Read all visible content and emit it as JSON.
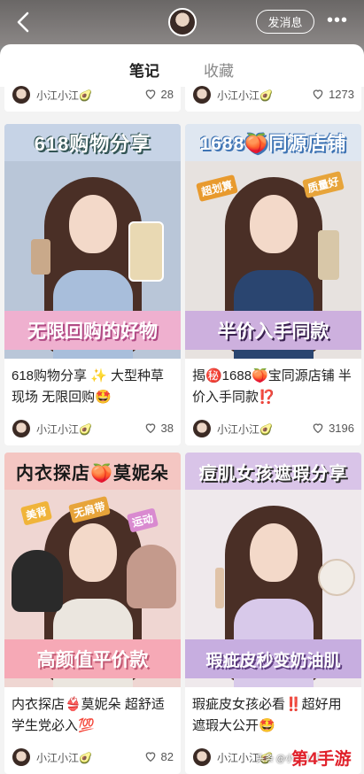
{
  "header": {
    "message_button": "发消息",
    "more": "•••"
  },
  "tabs": [
    {
      "label": "笔记",
      "active": true
    },
    {
      "label": "收藏",
      "active": false
    }
  ],
  "top_strip": {
    "left": {
      "author": "小江小江🥑",
      "likes": "28"
    },
    "right": {
      "author": "小江小江🥑",
      "likes": "1273"
    }
  },
  "cards": [
    {
      "banner": "618购物分享",
      "footer": "无限回购的好物",
      "title": "618购物分享 ✨ 大型种草现场 无限回购🤩",
      "author": "小江小江🥑",
      "likes": "38",
      "colors": {
        "bg": "#b8c8dc",
        "banner": "#c9d8ea",
        "text": "#ffffff",
        "footer": "#e9a7c8",
        "body": "#9fb7d6"
      }
    },
    {
      "banner": "1688🍑同源店铺",
      "stickers": [
        "超划算",
        "质量好"
      ],
      "footer": "半价入手同款",
      "title": "揭㊙️1688🍑宝同源店铺 半价入手同款⁉️",
      "author": "小江小江🥑",
      "likes": "3196",
      "colors": {
        "bg": "#e8e4e1",
        "banner": "#5a8fc7",
        "text": "#ffffff",
        "footer": "#c9a6d8",
        "body": "#27436b"
      }
    },
    {
      "banner": "内衣探店🍑莫妮朵",
      "stickers": [
        "美背",
        "无肩带",
        "运动"
      ],
      "footer": "高颜值平价款",
      "title": "内衣探店👙莫妮朵 超舒适 学生党必入💯",
      "author": "小江小江🥑",
      "likes": "82",
      "colors": {
        "bg": "#f1d6d0",
        "banner": "#f2c0bb",
        "text": "#1d1d1d",
        "footer": "#f1a6b2",
        "body": "#e9e3da"
      }
    },
    {
      "banner": "痘肌女孩遮瑕分享",
      "footer": "瑕疵皮秒变奶油肌",
      "title": "瑕疵皮女孩必看‼️超好用遮瑕大公开🤩",
      "author": "小江小江🥑",
      "likes": "",
      "colors": {
        "bg": "#ede7e9",
        "banner": "#c7b0d8",
        "text": "#2a2a2a",
        "footer": "#b79ad4",
        "body": "#d7c6e8"
      }
    }
  ],
  "watermark": {
    "small": "头条 @小江小江",
    "big": "第4手游"
  }
}
